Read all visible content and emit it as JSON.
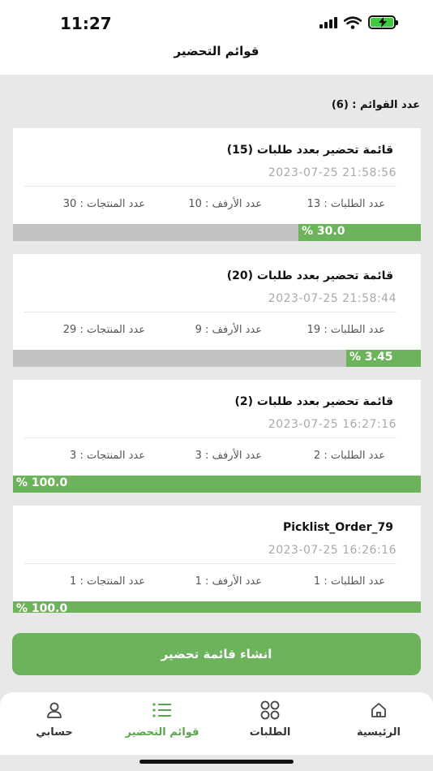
{
  "status": {
    "time": "11:27"
  },
  "header": {
    "title": "قوائم التحضير"
  },
  "summary": {
    "count_label": "عدد القوائم : (6)"
  },
  "lists": [
    {
      "title": "قائمة تحضير بعدد طلبات (15)",
      "date": "2023-07-25 21:58:56",
      "orders": "عدد الطلبات : 13",
      "shelves": "عدد الأرفف : 10",
      "products": "عدد المنتجات : 30",
      "progress_text": "% 30.0",
      "progress": 0.3
    },
    {
      "title": "قائمة تحضير بعدد طلبات (20)",
      "date": "2023-07-25 21:58:44",
      "orders": "عدد الطلبات : 19",
      "shelves": "عدد الأرفف : 9",
      "products": "عدد المنتجات : 29",
      "progress_text": "% 3.45",
      "progress": 0.0345
    },
    {
      "title": "قائمة تحضير بعدد طلبات (2)",
      "date": "2023-07-25 16:27:16",
      "orders": "عدد الطلبات : 2",
      "shelves": "عدد الأرفف : 3",
      "products": "عدد المنتجات : 3",
      "progress_text": "% 100.0",
      "progress": 1.0
    },
    {
      "title": "Picklist_Order_79",
      "date": "2023-07-25 16:26:16",
      "orders": "عدد الطلبات : 1",
      "shelves": "عدد الأرفف : 1",
      "products": "عدد المنتجات : 1",
      "progress_text": "% 100.0",
      "progress": 1.0
    }
  ],
  "create_button": "انشاء قائمة تحضير",
  "tabs": [
    {
      "label": "الرئيسية",
      "icon": "home-icon",
      "active": false
    },
    {
      "label": "الطلبات",
      "icon": "orders-grid-icon",
      "active": false
    },
    {
      "label": "قوائم التحضير",
      "icon": "list-icon",
      "active": true
    },
    {
      "label": "حسابي",
      "icon": "user-icon",
      "active": false
    }
  ],
  "colors": {
    "accent": "#6db35b",
    "track": "#c2c2c2",
    "active_tab": "#5aa64a"
  }
}
